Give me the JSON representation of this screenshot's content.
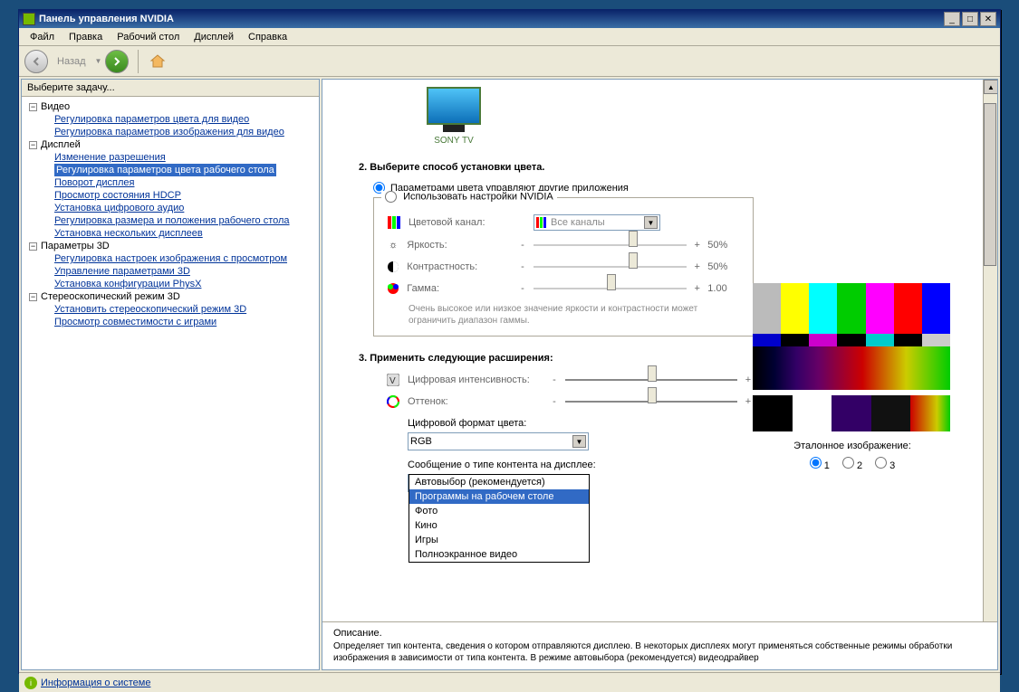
{
  "window": {
    "title": "Панель управления NVIDIA"
  },
  "menu": {
    "file": "Файл",
    "edit": "Правка",
    "desktop": "Рабочий стол",
    "display": "Дисплей",
    "help": "Справка"
  },
  "toolbar": {
    "back": "Назад"
  },
  "sidebar": {
    "header": "Выберите задачу...",
    "groups": [
      {
        "name": "Видео",
        "items": [
          "Регулировка параметров цвета для видео",
          "Регулировка параметров изображения для видео"
        ]
      },
      {
        "name": "Дисплей",
        "items": [
          "Изменение разрешения",
          "Регулировка параметров цвета рабочего стола",
          "Поворот дисплея",
          "Просмотр состояния HDCP",
          "Установка цифрового аудио",
          "Регулировка размера и положения рабочего стола",
          "Установка нескольких дисплеев"
        ],
        "selected": 1
      },
      {
        "name": "Параметры 3D",
        "items": [
          "Регулировка настроек изображения с просмотром",
          "Управление параметрами 3D",
          "Установка конфигурации PhysX"
        ]
      },
      {
        "name": "Стереоскопический режим 3D",
        "items": [
          "Установить стереоскопический режим 3D",
          "Просмотр совместимости с играми"
        ]
      }
    ]
  },
  "content": {
    "monitor_label": "SONY TV",
    "step2": "2. Выберите способ установки цвета.",
    "radio_other": "Параметрами цвета управляют другие приложения",
    "radio_nvidia": "Использовать настройки NVIDIA",
    "channel_lbl": "Цветовой канал:",
    "channel_val": "Все каналы",
    "brightness_lbl": "Яркость:",
    "brightness_val": "50%",
    "contrast_lbl": "Контрастность:",
    "contrast_val": "50%",
    "gamma_lbl": "Гамма:",
    "gamma_val": "1.00",
    "note": "Очень высокое или низкое значение яркости и контрастности может ограничить диапазон гаммы.",
    "step3": "3. Применить следующие расширения:",
    "digital_lbl": "Цифровая интенсивность:",
    "digital_val": "50%",
    "hue_lbl": "Оттенок:",
    "hue_val": "0°",
    "colorfmt_lbl": "Цифровой формат цвета:",
    "colorfmt_val": "RGB",
    "contentmsg_lbl": "Сообщение о типе контента на дисплее:",
    "contentmsg_val": "Программы на рабочем столе",
    "popup": [
      "Автовыбор (рекомендуется)",
      "Программы на рабочем столе",
      "Фото",
      "Кино",
      "Игры",
      "Полноэкранное видео"
    ],
    "ref_lbl": "Эталонное изображение:",
    "ref_opts": [
      "1",
      "2",
      "3"
    ],
    "desc_h": "Описание.",
    "desc_txt": "Определяет тип контента, сведения о котором отправляются дисплею. В некоторых дисплеях могут применяться собственные режимы обработки изображения в зависимости от типа контента. В режиме автовыбора (рекомендуется) видеодрайвер"
  },
  "status": {
    "link": "Информация о системе"
  }
}
